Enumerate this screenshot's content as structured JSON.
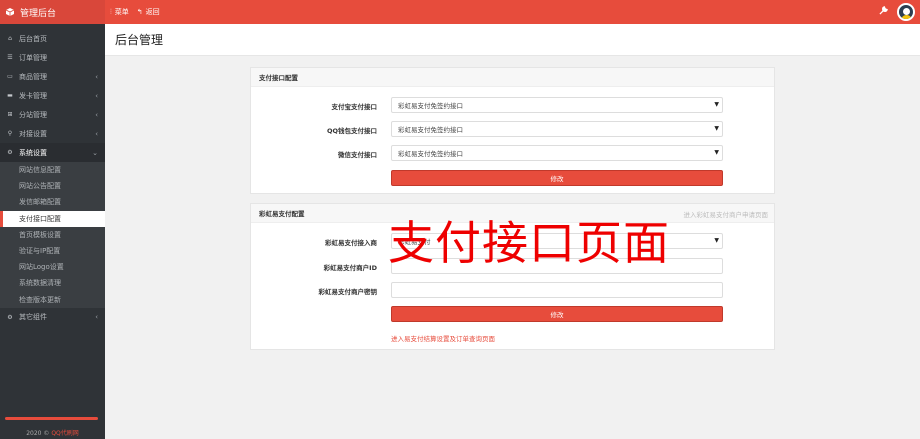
{
  "app": {
    "title": "管理后台"
  },
  "topbar": {
    "menu_label": "菜单",
    "back_label": "返回"
  },
  "sidebar": {
    "items": [
      {
        "label": "后台首页",
        "icon": "home-icon"
      },
      {
        "label": "订单管理",
        "icon": "list-icon"
      },
      {
        "label": "商品管理",
        "icon": "box-icon"
      },
      {
        "label": "发卡管理",
        "icon": "card-icon"
      },
      {
        "label": "分站管理",
        "icon": "sitemap-icon"
      },
      {
        "label": "对接设置",
        "icon": "link-icon"
      },
      {
        "label": "系统设置",
        "icon": "gear-icon"
      }
    ],
    "submenu": [
      "网站信息配置",
      "网站公告配置",
      "发信邮箱配置",
      "支付接口配置",
      "首页模板设置",
      "验证与IP配置",
      "网站Logo设置",
      "系统数据清理",
      "检查版本更新"
    ],
    "other": {
      "label": "其它组件",
      "icon": "cogs-icon"
    },
    "footer": {
      "copyright": "2020 ©",
      "site": "QQ代刷网"
    }
  },
  "page": {
    "title": "后台管理"
  },
  "panel1": {
    "title": "支付接口配置",
    "rows": [
      {
        "label": "支付宝支付接口",
        "value": "彩虹易支付免签约接口"
      },
      {
        "label": "QQ钱包支付接口",
        "value": "彩虹易支付免签约接口"
      },
      {
        "label": "微信支付接口",
        "value": "彩虹易支付免签约接口"
      }
    ],
    "submit": "修改"
  },
  "panel2": {
    "title": "彩虹易支付配置",
    "head_link": "进入彩虹易支付商户申请页面",
    "provider_label": "彩虹易支付接入商",
    "provider_value": "彩虹易支付",
    "merchant_id_label": "彩虹易支付商户ID",
    "merchant_key_label": "彩虹易支付商户密钥",
    "submit": "修改",
    "footer_link": "进入易支付结算设置及订单查询页面"
  },
  "overlay": {
    "text": "支付接口页面"
  },
  "colors": {
    "accent": "#e74c3c",
    "sidebar": "#2f3337"
  }
}
